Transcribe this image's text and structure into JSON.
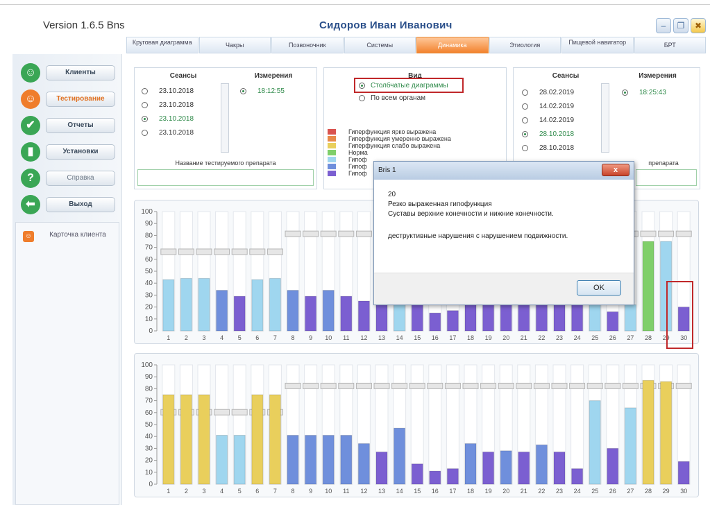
{
  "app": {
    "version": "Version 1.6.5 Bns",
    "patient_name": "Сидоров Иван Иванович",
    "window_buttons": [
      "minimize-icon",
      "maximize-icon",
      "close-icon"
    ]
  },
  "tabs": [
    {
      "label": "Круговая диаграмма",
      "active": false
    },
    {
      "label": "Чакры",
      "active": false
    },
    {
      "label": "Позвоночник",
      "active": false
    },
    {
      "label": "Системы",
      "active": false
    },
    {
      "label": "Динамика",
      "active": true
    },
    {
      "label": "Этиология",
      "active": false
    },
    {
      "label": "Пищевой навигатор",
      "active": false
    },
    {
      "label": "БРТ",
      "active": false
    }
  ],
  "sidebar": {
    "items": [
      {
        "label": "Клиенты",
        "icon": "person-icon",
        "color": "#3aa655"
      },
      {
        "label": "Тестирование",
        "icon": "person-orange-icon",
        "color": "#ef7d2c",
        "active": true
      },
      {
        "label": "Отчеты",
        "icon": "checkmark-icon",
        "color": "#3aa655"
      },
      {
        "label": "Установки",
        "icon": "settings-bars-icon",
        "color": "#3aa655"
      },
      {
        "label": "Справка",
        "icon": "question-icon",
        "color": "#3aa655"
      },
      {
        "label": "Выход",
        "icon": "exit-arrow-icon",
        "color": "#3aa655"
      }
    ],
    "card_label": "Карточка клиента"
  },
  "left_panel": {
    "sessions_title": "Сеансы",
    "measures_title": "Измерения",
    "sessions": [
      {
        "date": "23.10.2018",
        "selected": false
      },
      {
        "date": "23.10.2018",
        "selected": false
      },
      {
        "date": "23.10.2018",
        "selected": true
      },
      {
        "date": "23.10.2018",
        "selected": false
      }
    ],
    "measure": {
      "time": "18:12:55",
      "selected": true
    },
    "drug_label": "Название тестируемого препарата",
    "drug_value": ""
  },
  "view_panel": {
    "title": "Вид",
    "options": [
      {
        "label": "Столбчатые диаграммы",
        "selected": true
      },
      {
        "label": "По всем органам",
        "selected": false
      }
    ],
    "legend": [
      {
        "label": "Гиперфункция ярко выражена",
        "color": "#d9534f"
      },
      {
        "label": "Гиперфункция умеренно выражена",
        "color": "#e88a4a"
      },
      {
        "label": "Гиперфункция слабо выражена",
        "color": "#e9cf5c"
      },
      {
        "label": "Норма",
        "color": "#7fcf6a"
      },
      {
        "label": "Гипоф",
        "color": "#9fd6ef"
      },
      {
        "label": "Гипоф",
        "color": "#6f8fdc"
      },
      {
        "label": "Гипоф",
        "color": "#7b5fd1"
      }
    ]
  },
  "right_panel": {
    "sessions_title": "Сеансы",
    "measures_title": "Измерения",
    "sessions": [
      {
        "date": "28.02.2019",
        "selected": false
      },
      {
        "date": "14.02.2019",
        "selected": false
      },
      {
        "date": "14.02.2019",
        "selected": false
      },
      {
        "date": "28.10.2018",
        "selected": true
      },
      {
        "date": "28.10.2018",
        "selected": false
      }
    ],
    "measure": {
      "time": "18:25:43",
      "selected": true
    },
    "drug_label_fragment": "препарата",
    "drug_value": ""
  },
  "dialog": {
    "title": "Bris 1",
    "lines": [
      "20",
      "Резко выраженная гипофункция",
      "Суставы верхние конечности и нижние конечности.",
      "",
      "деструктивные нарушения с нарушением подвижности."
    ],
    "ok_label": "OK",
    "close_label": "x"
  },
  "colors": {
    "hypo_light": "#9fd6ef",
    "hypo_mid": "#6f8fdc",
    "hypo_strong": "#7b5fd1",
    "norm": "#7fcf6a",
    "hyper_weak": "#e9cf5c",
    "tab_active": "#f2822e",
    "highlight_frame": "#c0282a"
  },
  "chart_data": [
    {
      "type": "bar",
      "title": "",
      "xlabel": "",
      "ylabel": "",
      "ylim": [
        0,
        100
      ],
      "yticks": [
        0,
        10,
        20,
        30,
        40,
        50,
        60,
        70,
        80,
        90,
        100
      ],
      "categories": [
        "1",
        "2",
        "3",
        "4",
        "5",
        "6",
        "7",
        "8",
        "9",
        "10",
        "11",
        "12",
        "13",
        "14",
        "15",
        "16",
        "17",
        "18",
        "19",
        "20",
        "21",
        "22",
        "23",
        "24",
        "25",
        "26",
        "27",
        "28",
        "29",
        "30"
      ],
      "values": [
        43,
        44,
        44,
        34,
        29,
        43,
        44,
        34,
        29,
        34,
        29,
        25,
        22,
        22,
        22,
        15,
        17,
        22,
        22,
        22,
        22,
        22,
        22,
        22,
        22,
        16,
        22,
        75,
        75,
        20
      ],
      "bar_colors": [
        "#9fd6ef",
        "#9fd6ef",
        "#9fd6ef",
        "#6f8fdc",
        "#7b5fd1",
        "#9fd6ef",
        "#9fd6ef",
        "#6f8fdc",
        "#7b5fd1",
        "#6f8fdc",
        "#7b5fd1",
        "#7b5fd1",
        "#7b5fd1",
        "#9fd6ef",
        "#7b5fd1",
        "#7b5fd1",
        "#7b5fd1",
        "#7b5fd1",
        "#7b5fd1",
        "#7b5fd1",
        "#7b5fd1",
        "#7b5fd1",
        "#7b5fd1",
        "#7b5fd1",
        "#9fd6ef",
        "#7b5fd1",
        "#9fd6ef",
        "#7fcf6a",
        "#9fd6ef",
        "#7b5fd1"
      ],
      "reference_markers": [
        64,
        64,
        64,
        64,
        64,
        64,
        64,
        79,
        79,
        79,
        79,
        79,
        79,
        79,
        79,
        79,
        79,
        79,
        79,
        79,
        79,
        79,
        79,
        79,
        79,
        79,
        79,
        79,
        79,
        79
      ],
      "highlighted_category": "30"
    },
    {
      "type": "bar",
      "title": "",
      "xlabel": "",
      "ylabel": "",
      "ylim": [
        0,
        100
      ],
      "yticks": [
        0,
        10,
        20,
        30,
        40,
        50,
        60,
        70,
        80,
        90,
        100
      ],
      "categories": [
        "1",
        "2",
        "3",
        "4",
        "5",
        "6",
        "7",
        "8",
        "9",
        "10",
        "11",
        "12",
        "13",
        "14",
        "15",
        "16",
        "17",
        "18",
        "19",
        "20",
        "21",
        "22",
        "23",
        "24",
        "25",
        "26",
        "27",
        "28",
        "29",
        "30"
      ],
      "values": [
        75,
        75,
        75,
        41,
        41,
        75,
        75,
        41,
        41,
        41,
        41,
        34,
        27,
        47,
        17,
        11,
        13,
        34,
        27,
        28,
        27,
        33,
        27,
        13,
        70,
        30,
        64,
        87,
        86,
        19
      ],
      "bar_colors": [
        "#e9cf5c",
        "#e9cf5c",
        "#e9cf5c",
        "#9fd6ef",
        "#9fd6ef",
        "#e9cf5c",
        "#e9cf5c",
        "#6f8fdc",
        "#6f8fdc",
        "#6f8fdc",
        "#6f8fdc",
        "#6f8fdc",
        "#7b5fd1",
        "#6f8fdc",
        "#7b5fd1",
        "#7b5fd1",
        "#7b5fd1",
        "#6f8fdc",
        "#7b5fd1",
        "#6f8fdc",
        "#7b5fd1",
        "#6f8fdc",
        "#7b5fd1",
        "#7b5fd1",
        "#9fd6ef",
        "#7b5fd1",
        "#9fd6ef",
        "#e9cf5c",
        "#e9cf5c",
        "#7b5fd1"
      ],
      "reference_markers": [
        58,
        58,
        58,
        58,
        58,
        58,
        58,
        80,
        80,
        80,
        80,
        80,
        80,
        80,
        80,
        80,
        80,
        80,
        80,
        80,
        80,
        80,
        80,
        80,
        80,
        80,
        80,
        80,
        80,
        80
      ]
    }
  ]
}
